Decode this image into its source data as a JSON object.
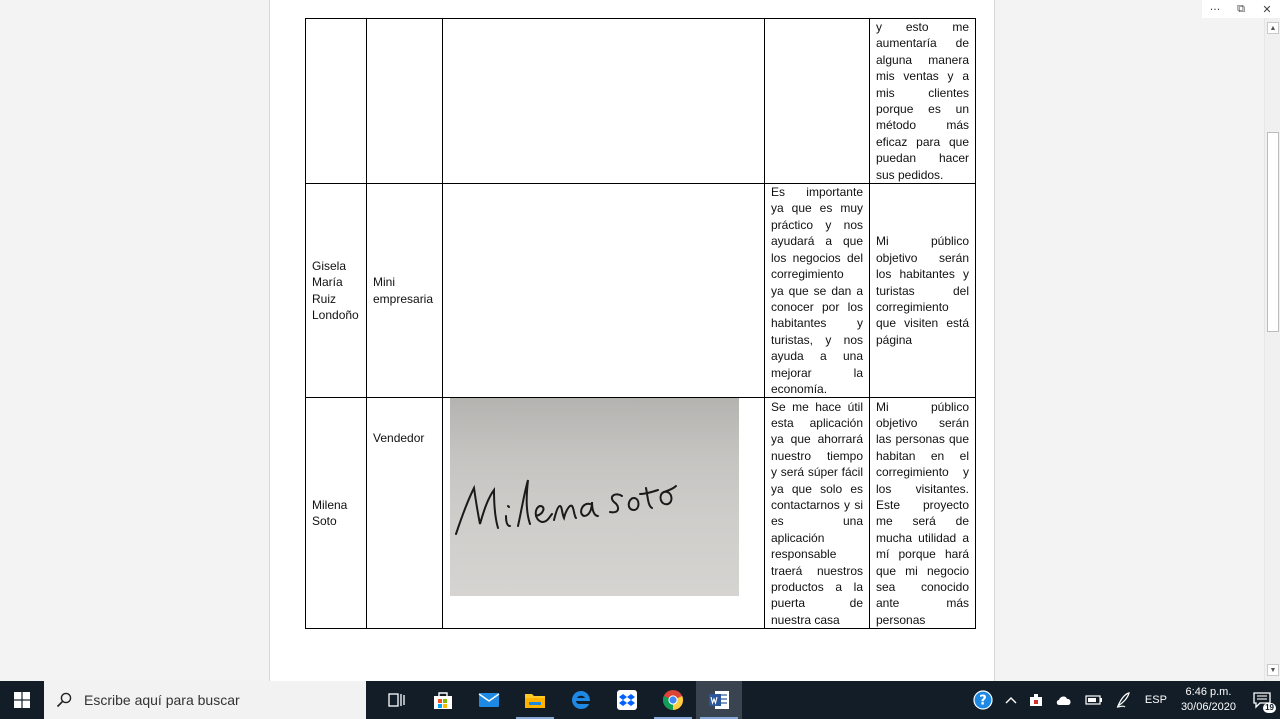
{
  "window": {
    "more_label": "···",
    "restore_label": "⧉",
    "close_label": "✕"
  },
  "table": {
    "row1": {
      "col4": "",
      "col5_lines": [
        "y    esto    me",
        "aumentaría de",
        "alguna manera",
        "mis ventas y a",
        "mis      clientes",
        "porque es un",
        "método      más",
        "eficaz para que",
        "puedan    hacer",
        "sus pedidos."
      ]
    },
    "row2": {
      "name_lines": [
        "Gisela",
        "María",
        "Ruiz",
        "Londoño"
      ],
      "role_lines": [
        "Mini",
        "empresaria"
      ],
      "col4_lines": [
        "Es    importante",
        "ya que es muy",
        "práctico y nos",
        "ayudará a que",
        "los negocios del",
        "corregimiento",
        "ya que se dan a",
        "conocer por los",
        "habitantes     y",
        "turistas, y nos",
        "ayuda  a  una",
        "mejorar        la",
        "economía."
      ],
      "col5_lines": [
        "Mi         público",
        "objetivo    serán",
        "los habitantes y",
        "turistas       del",
        "corregimiento",
        "que visiten está",
        "página"
      ]
    },
    "row3": {
      "name_lines": [
        "Milena",
        "Soto"
      ],
      "role": "Vendedor",
      "signature_text": "Milena soto",
      "col4_lines": [
        "Se me hace útil",
        "esta  aplicación",
        "ya que ahorrará",
        "nuestro tiempo",
        "y será súper fácil",
        "ya que solo es",
        "contactarnos y si",
        "es               una",
        "aplicación",
        "responsable",
        "traerá nuestros",
        "productos a la",
        "puerta          de",
        "nuestra casa"
      ],
      "col5_lines": [
        "Mi         público",
        "objetivo    serán",
        "las personas que",
        "habitan  en  el",
        "corregimiento y",
        "los visitantes.",
        "Este     proyecto",
        "me     será     de",
        "mucha utilidad a",
        "mí porque hará",
        "que mi negocio",
        "sea      conocido",
        "ante            más",
        "personas"
      ]
    }
  },
  "taskbar": {
    "search_placeholder": "Escribe aquí para buscar",
    "language": "ESP",
    "time": "6:46 p.m.",
    "date": "30/06/2020",
    "notifications_count": "19"
  },
  "colors": {
    "taskbar_bg": "#121d28",
    "word_blue": "#2b579a",
    "accent": "#0078d7"
  }
}
